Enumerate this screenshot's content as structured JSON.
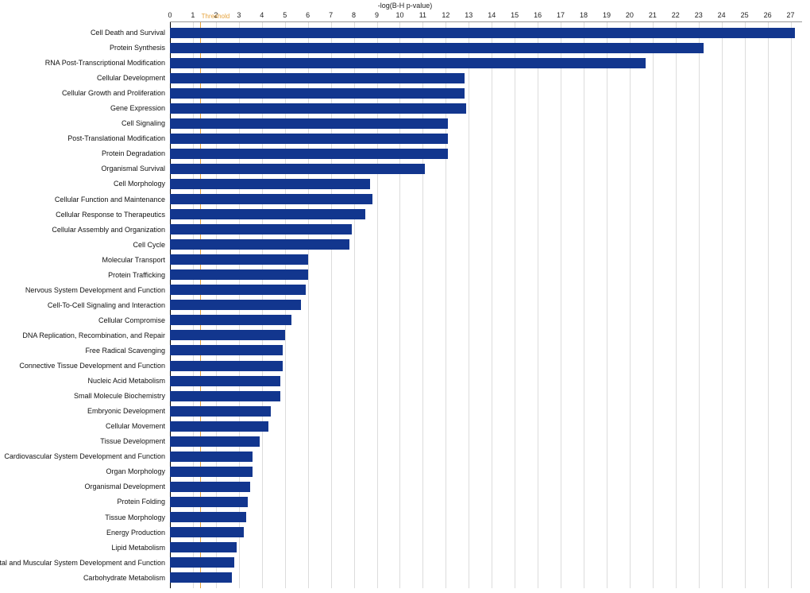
{
  "chart_data": {
    "type": "bar",
    "orientation": "horizontal",
    "title": "",
    "xlabel": "-log(B-H p-value)",
    "ylabel": "",
    "xlim": [
      0,
      27.5
    ],
    "ticks": [
      0,
      1,
      2,
      3,
      4,
      5,
      6,
      7,
      8,
      9,
      10,
      11,
      12,
      13,
      14,
      15,
      16,
      17,
      18,
      19,
      20,
      21,
      22,
      23,
      24,
      25,
      26,
      27
    ],
    "threshold": {
      "value": 1.3,
      "label": "Threshold"
    },
    "categories": [
      "Cell Death and Survival",
      "Protein Synthesis",
      "RNA Post-Transcriptional Modification",
      "Cellular Development",
      "Cellular Growth and Proliferation",
      "Gene Expression",
      "Cell Signaling",
      "Post-Translational Modification",
      "Protein Degradation",
      "Organismal Survival",
      "Cell Morphology",
      "Cellular Function and Maintenance",
      "Cellular Response to Therapeutics",
      "Cellular Assembly and Organization",
      "Cell Cycle",
      "Molecular Transport",
      "Protein Trafficking",
      "Nervous System Development and Function",
      "Cell-To-Cell Signaling and Interaction",
      "Cellular Compromise",
      "DNA Replication, Recombination, and Repair",
      "Free Radical Scavenging",
      "Connective Tissue Development and Function",
      "Nucleic Acid Metabolism",
      "Small Molecule Biochemistry",
      "Embryonic Development",
      "Cellular Movement",
      "Tissue Development",
      "Cardiovascular System Development and Function",
      "Organ Morphology",
      "Organismal Development",
      "Protein Folding",
      "Tissue Morphology",
      "Energy Production",
      "Lipid Metabolism",
      "Skeletal and Muscular System Development and Function",
      "Carbohydrate Metabolism"
    ],
    "values": [
      27.2,
      23.2,
      20.7,
      12.8,
      12.8,
      12.9,
      12.1,
      12.1,
      12.1,
      11.1,
      8.7,
      8.8,
      8.5,
      7.9,
      7.8,
      6.0,
      6.0,
      5.9,
      5.7,
      5.3,
      5.0,
      4.9,
      4.9,
      4.8,
      4.8,
      4.4,
      4.3,
      3.9,
      3.6,
      3.6,
      3.5,
      3.4,
      3.3,
      3.2,
      2.9,
      2.8,
      2.7
    ],
    "bar_color": "#12368e",
    "threshold_color": "#e6a23c"
  }
}
